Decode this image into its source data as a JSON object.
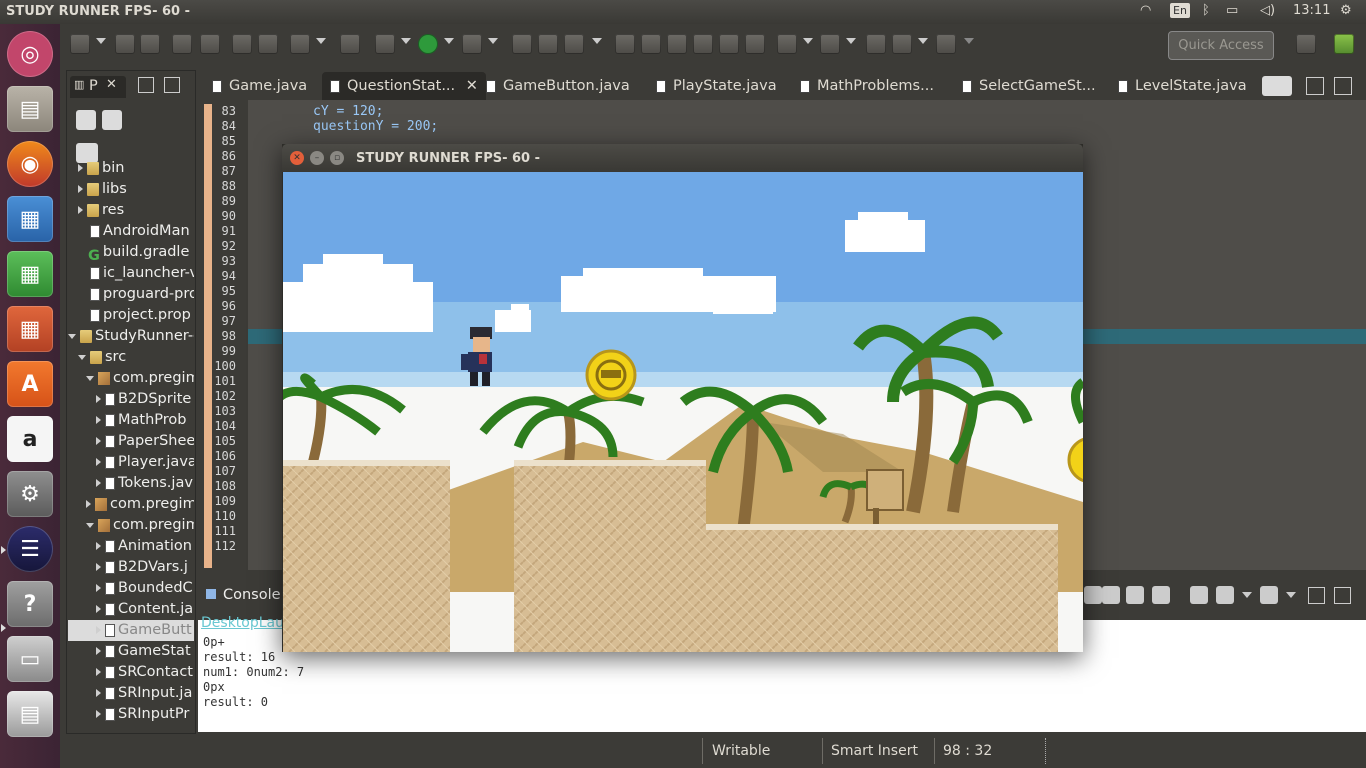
{
  "top_panel": {
    "title": "STUDY RUNNER  FPS- 60 -",
    "keyboard_lang": "En",
    "clock": "13:11"
  },
  "toolbar": {
    "quick_access_placeholder": "Quick Access"
  },
  "package_explorer": {
    "tab_label": "P",
    "items": [
      {
        "label": "bin",
        "kind": "folder",
        "expanded": false
      },
      {
        "label": "libs",
        "kind": "folder",
        "expanded": false
      },
      {
        "label": "res",
        "kind": "folder",
        "expanded": false
      },
      {
        "label": "AndroidMan",
        "kind": "file"
      },
      {
        "label": "build.gradle",
        "kind": "gradle"
      },
      {
        "label": "ic_launcher-v",
        "kind": "file"
      },
      {
        "label": "proguard-pro",
        "kind": "file"
      },
      {
        "label": "project.prop",
        "kind": "file"
      },
      {
        "label": "StudyRunner-c",
        "kind": "project",
        "expanded": true
      },
      {
        "label": "src",
        "kind": "folder",
        "expanded": true
      },
      {
        "label": "com.pregim",
        "kind": "package",
        "expanded": true
      },
      {
        "label": "B2DSprite",
        "kind": "java"
      },
      {
        "label": "MathProb",
        "kind": "java"
      },
      {
        "label": "PaperShee",
        "kind": "java"
      },
      {
        "label": "Player.java",
        "kind": "java"
      },
      {
        "label": "Tokens.jav",
        "kind": "java"
      },
      {
        "label": "com.pregim",
        "kind": "package",
        "expanded": false
      },
      {
        "label": "com.pregim",
        "kind": "package",
        "expanded": true
      },
      {
        "label": "Animation",
        "kind": "java"
      },
      {
        "label": "B2DVars.j",
        "kind": "java"
      },
      {
        "label": "BoundedC",
        "kind": "java"
      },
      {
        "label": "Content.ja",
        "kind": "java"
      },
      {
        "label": "GameButt",
        "kind": "java",
        "selected": true
      },
      {
        "label": "GameStat",
        "kind": "java"
      },
      {
        "label": "SRContact",
        "kind": "java"
      },
      {
        "label": "SRInput.ja",
        "kind": "java"
      },
      {
        "label": "SRInputPr",
        "kind": "java"
      }
    ]
  },
  "editor": {
    "tabs": [
      {
        "label": "Game.java"
      },
      {
        "label": "QuestionStat...",
        "active": true
      },
      {
        "label": "GameButton.java"
      },
      {
        "label": "PlayState.java"
      },
      {
        "label": "MathProblems..."
      },
      {
        "label": "SelectGameSt..."
      },
      {
        "label": "LevelState.java"
      }
    ],
    "line_numbers": [
      "83",
      "84",
      "85",
      "86",
      "87",
      "88",
      "89",
      "90",
      "91",
      "92",
      "93",
      "94",
      "95",
      "96",
      "97",
      "98",
      "99",
      "100",
      "101",
      "102",
      "103",
      "104",
      "105",
      "106",
      "107",
      "108",
      "109",
      "110",
      "111",
      "112"
    ],
    "code_lines": [
      "cY = 120;",
      "questionY = 200;"
    ]
  },
  "console": {
    "tab_label": "Console",
    "launch_link": "DesktopLau",
    "lines": [
      "0p+",
      "result: 16",
      "num1: 0num2: 7",
      "0px",
      "result: 0"
    ]
  },
  "status_bar": {
    "writable": "Writable",
    "insert_mode": "Smart Insert",
    "position": "98 : 32"
  },
  "game_window": {
    "title": "STUDY RUNNER  FPS- 60 -"
  },
  "colors": {
    "sky": "#6fa8e6",
    "sand_block": "#d9c09a",
    "dune": "#c9a86a",
    "palm_green": "#2e7d1e",
    "coin": "#f2d218",
    "line_highlight": "#2e6a78",
    "code_text": "#9ac8f7"
  }
}
